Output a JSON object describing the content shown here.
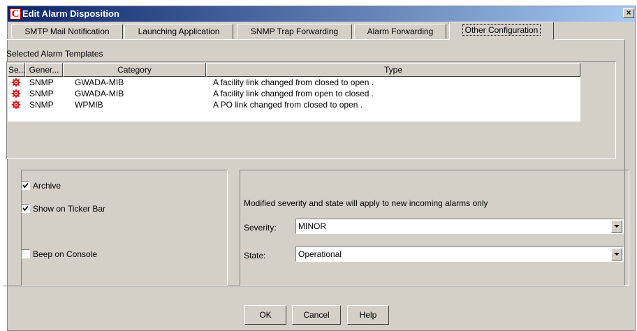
{
  "window": {
    "title": "Edit Alarm Disposition",
    "app_icon_letter": "C",
    "close_label": "×"
  },
  "tabs": [
    {
      "label": "SMTP Mail Notification",
      "active": false
    },
    {
      "label": "Launching Application",
      "active": false
    },
    {
      "label": "SNMP Trap Forwarding",
      "active": false
    },
    {
      "label": "Alarm Forwarding",
      "active": false
    },
    {
      "label": "Other Configuration",
      "active": true
    }
  ],
  "templates": {
    "section_label": "Selected Alarm Templates",
    "columns": [
      "Se...",
      "Gener...",
      "Category",
      "Type"
    ],
    "rows": [
      {
        "severity_icon": "alarm-burst-icon",
        "generator": "SNMP",
        "category": "GWADA-MIB",
        "type": "A facility link changed from closed to open ."
      },
      {
        "severity_icon": "alarm-burst-icon",
        "generator": "SNMP",
        "category": "GWADA-MIB",
        "type": "A facility link changed from open to closed ."
      },
      {
        "severity_icon": "alarm-burst-icon",
        "generator": "SNMP",
        "category": "WPMIB",
        "type": "A PO link changed from closed to open ."
      }
    ]
  },
  "options": {
    "archive": {
      "label": "Archive",
      "checked": true
    },
    "ticker": {
      "label": "Show on Ticker Bar",
      "checked": true
    },
    "beep": {
      "label": "Beep on Console",
      "checked": false
    }
  },
  "modify": {
    "info": "Modified severity and state will apply to new incoming alarms only",
    "severity_label": "Severity:",
    "severity_value": "MINOR",
    "state_label": "State:",
    "state_value": "Operational"
  },
  "buttons": {
    "ok": "OK",
    "cancel": "Cancel",
    "help": "Help"
  },
  "colors": {
    "title_start": "#0a246a",
    "title_end": "#a6caf0",
    "dialog_bg": "#d4d0c8",
    "alarm_icon": "#e01010"
  }
}
